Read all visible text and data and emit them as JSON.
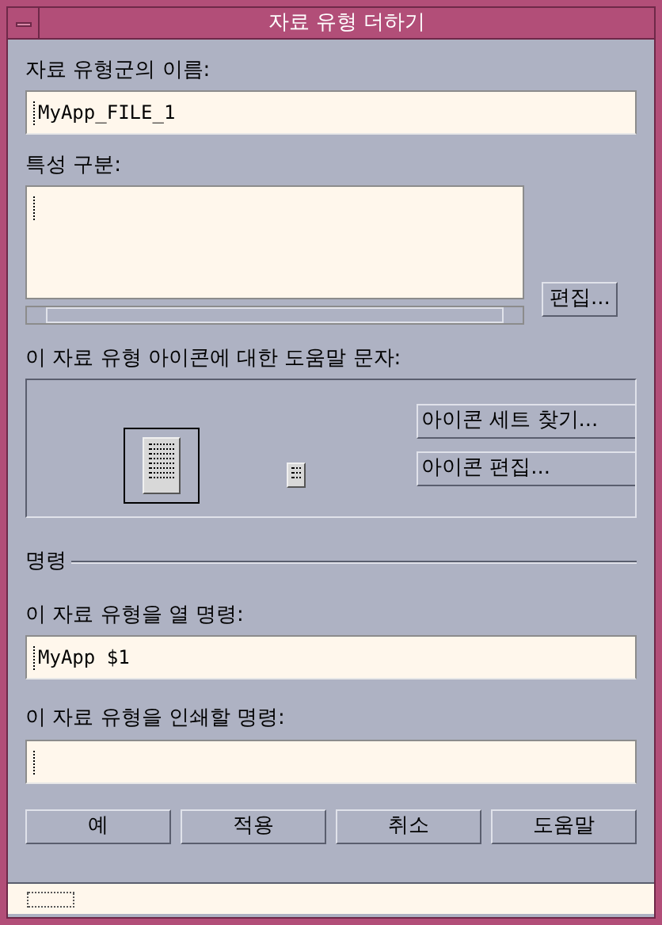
{
  "window": {
    "title": "자료 유형 더하기"
  },
  "name_field": {
    "label": "자료 유형군의 이름:",
    "value": "MyApp_FILE_1"
  },
  "characteristics": {
    "label": "특성 구분:",
    "edit_button": "편집..."
  },
  "help_text": {
    "label": "이 자료 유형 아이콘에 대한 도움말 문자:",
    "buttons": [
      "아이콘 세트 찾기...",
      "아이콘 편집..."
    ]
  },
  "commands": {
    "heading": "명령",
    "open_label": "이 자료 유형을 열 명령:",
    "open_value": "MyApp $1",
    "print_label": "이 자료 유형을 인쇄할 명령:"
  },
  "buttons": [
    "예",
    "적용",
    "취소",
    "도움말"
  ]
}
